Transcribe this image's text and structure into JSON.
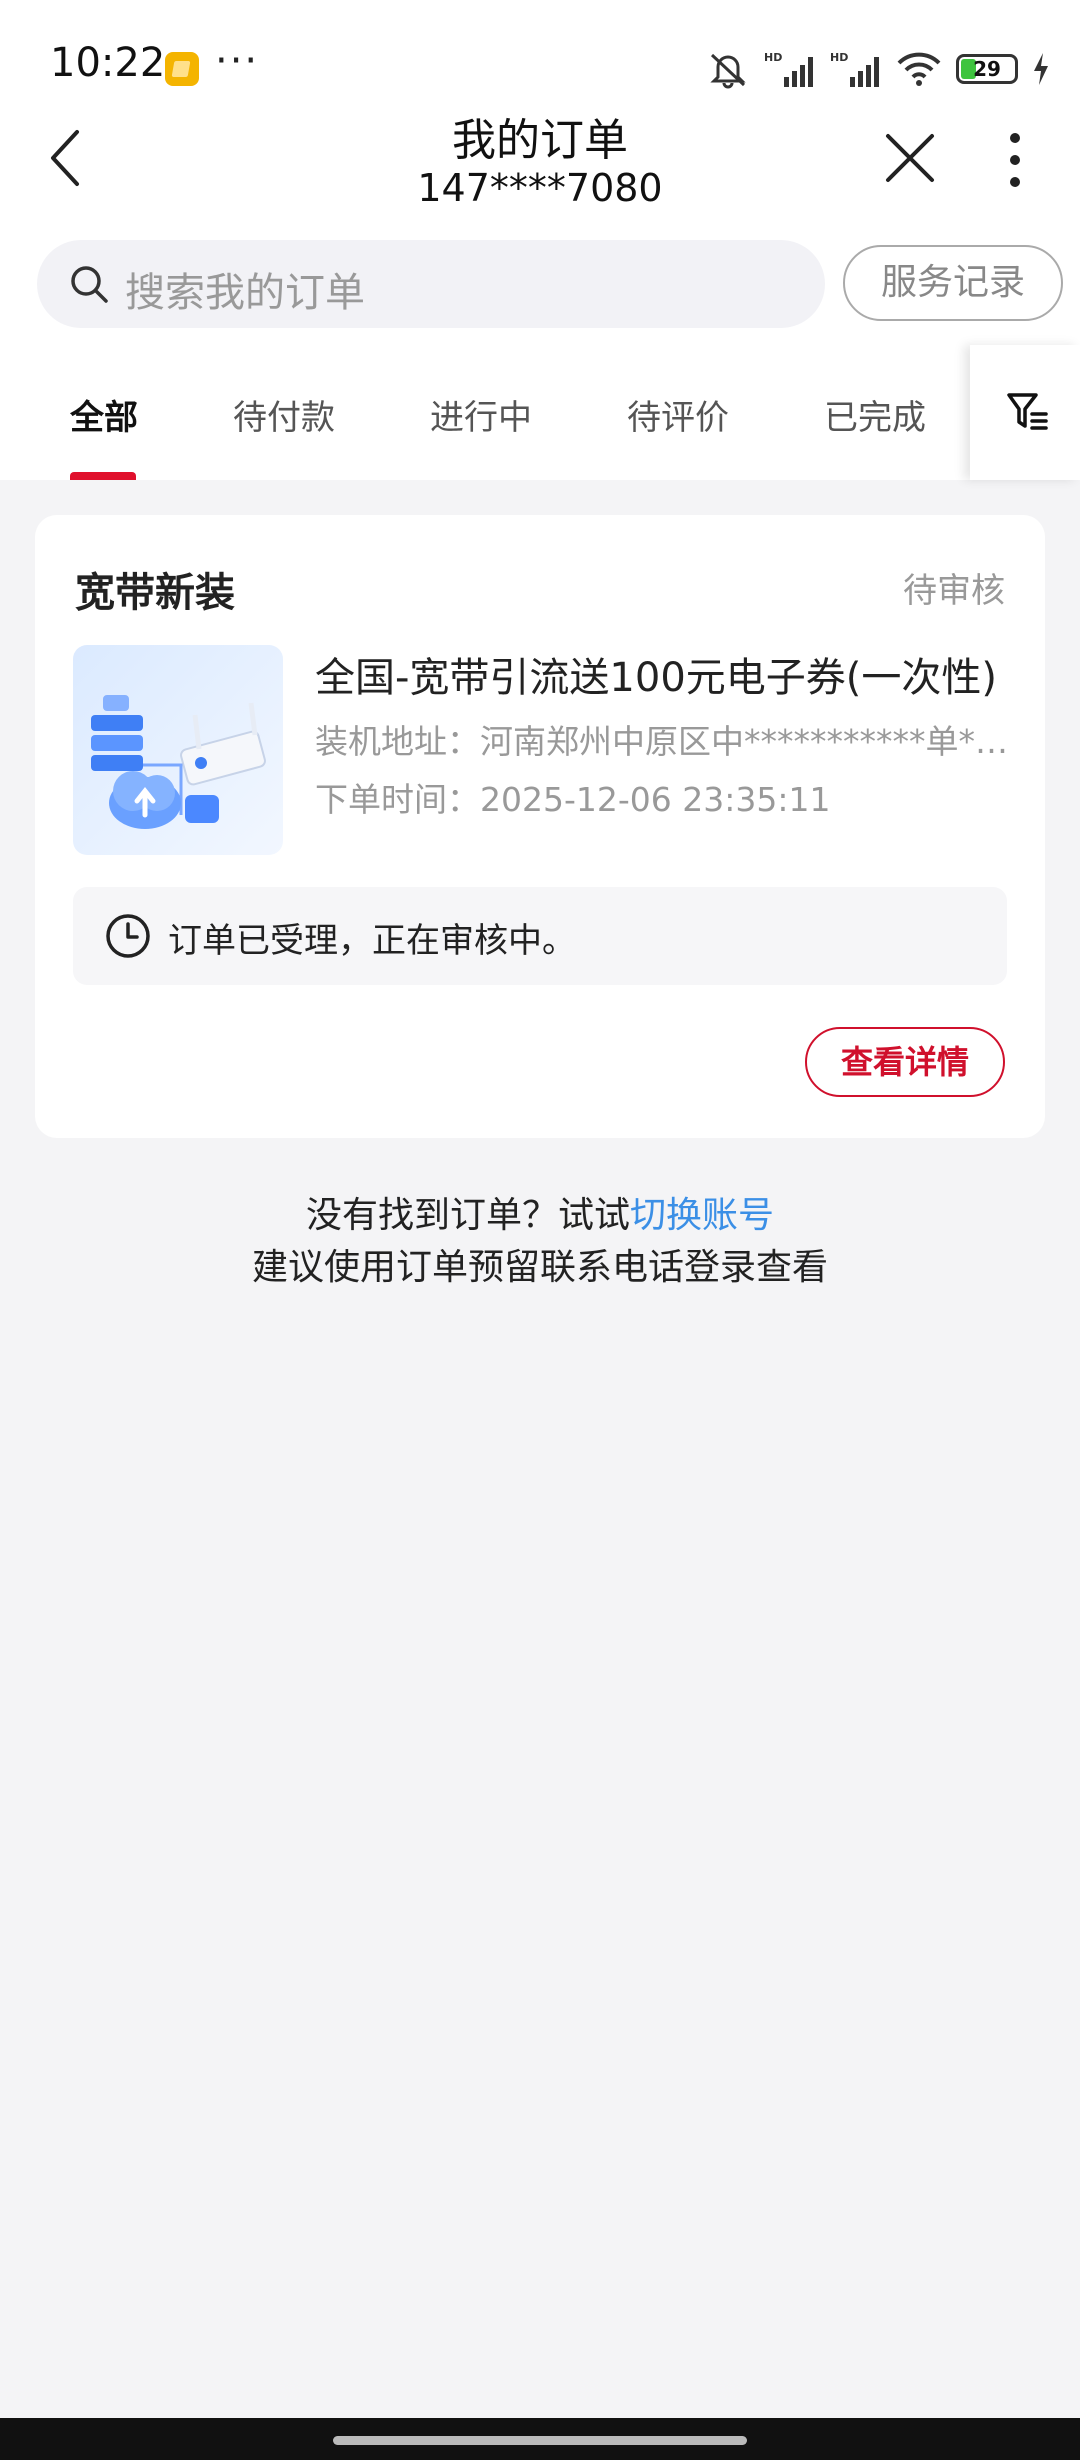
{
  "status_bar": {
    "time": "10:22",
    "overflow": "···",
    "battery_level": "29",
    "icons": [
      "notification-icon",
      "mute-icon",
      "signal-hd-icon",
      "signal-hd-icon",
      "wifi-icon",
      "battery-icon",
      "charging-icon"
    ]
  },
  "header": {
    "title": "我的订单",
    "subtitle": "147****7080"
  },
  "search": {
    "placeholder": "搜索我的订单",
    "service_record": "服务记录"
  },
  "tabs": [
    {
      "label": "全部",
      "active": true
    },
    {
      "label": "待付款",
      "active": false
    },
    {
      "label": "进行中",
      "active": false
    },
    {
      "label": "待评价",
      "active": false
    },
    {
      "label": "已完成",
      "active": false
    }
  ],
  "order": {
    "type": "宽带新装",
    "status": "待审核",
    "name": "全国-宽带引流送100元电子券(一次性)",
    "address_label": "装机地址：",
    "address": "河南郑州中原区中***********单******",
    "time_label": "下单时间：",
    "time": "2025-12-06 23:35:11",
    "note": "订单已受理，正在审核中。",
    "detail_button": "查看详情"
  },
  "hint": {
    "prefix": "没有找到订单？试试",
    "link": "切换账号",
    "line2": "建议使用订单预留联系电话登录查看"
  },
  "colors": {
    "accent": "#d0102c",
    "link": "#3b8fe6",
    "background": "#f4f4f6"
  }
}
